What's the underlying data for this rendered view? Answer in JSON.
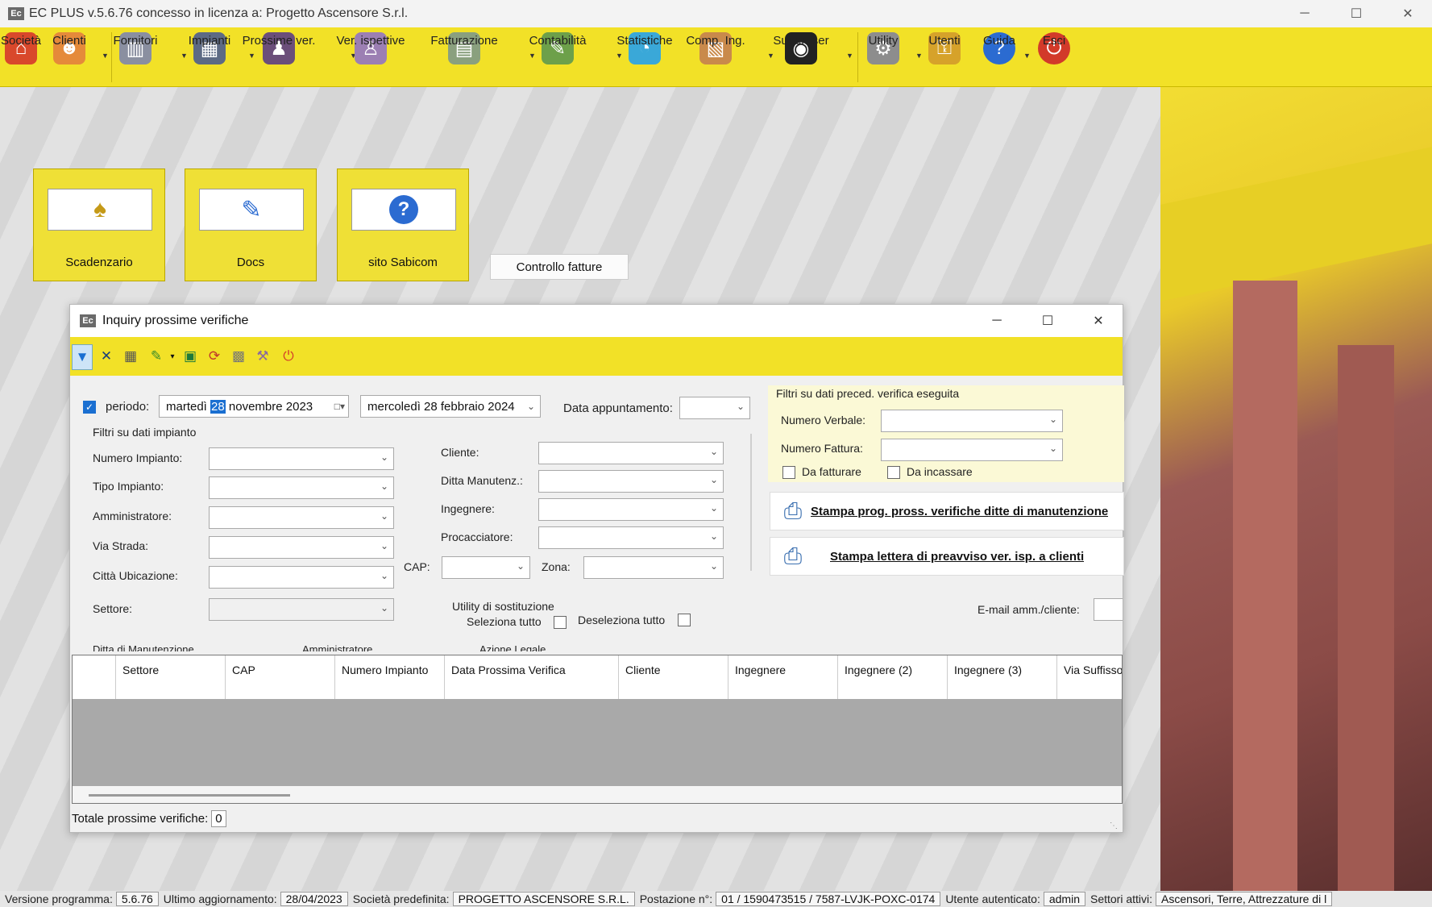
{
  "window": {
    "icon_text": "Ec",
    "title": "EC PLUS v.5.6.76 concesso in licenza a: Progetto Ascensore S.r.l.",
    "controls": {
      "minimize": "─",
      "maximize": "☐",
      "close": "✕"
    }
  },
  "toolbar": {
    "items": [
      {
        "label": "Società",
        "icon": "home-icon",
        "color": "#d9482b",
        "glyph": "⌂"
      },
      {
        "label": "Clienti",
        "icon": "users-icon",
        "color": "#e58a3a",
        "glyph": "☻"
      },
      {
        "label": "Fornitori",
        "icon": "factory-icon",
        "color": "#8a8fa0",
        "glyph": "▥"
      },
      {
        "label": "Impianti",
        "icon": "building-icon",
        "color": "#5d6a84",
        "glyph": "▦"
      },
      {
        "label": "Prossime ver.",
        "icon": "worker-icon",
        "color": "#6b4e7a",
        "glyph": "♟"
      },
      {
        "label": "Ver. ispettive",
        "icon": "inspector-icon",
        "color": "#9c7fb3",
        "glyph": "♙"
      },
      {
        "label": "Fatturazione",
        "icon": "calculator-icon",
        "color": "#8aa07e",
        "glyph": "▤"
      },
      {
        "label": "Contabilità",
        "icon": "accounting-icon",
        "color": "#6da04a",
        "glyph": "✎"
      },
      {
        "label": "Statistiche",
        "icon": "chart-icon",
        "color": "#3aa8d8",
        "glyph": "◔"
      },
      {
        "label": "Comp. Ing.",
        "icon": "box-icon",
        "color": "#c98a4b",
        "glyph": "▧"
      },
      {
        "label": "Superuser",
        "icon": "superuser-icon",
        "color": "#222222",
        "glyph": "◉"
      },
      {
        "label": "Utility",
        "icon": "gear-icon",
        "color": "#8d8d8d",
        "glyph": "⚙"
      },
      {
        "label": "Utenti",
        "icon": "key-icon",
        "color": "#d6a22a",
        "glyph": "⚿"
      },
      {
        "label": "Guida",
        "icon": "help-icon",
        "color": "#2b6bd1",
        "glyph": "?"
      },
      {
        "label": "Esci",
        "icon": "power-icon",
        "color": "#d23a2a",
        "glyph": "⏻"
      }
    ]
  },
  "tiles": [
    {
      "label": "Scadenzario",
      "icon": "bell-icon",
      "glyph": "🔔"
    },
    {
      "label": "Docs",
      "icon": "edit-document-icon",
      "glyph": "✎"
    },
    {
      "label": "sito Sabicom",
      "icon": "help-icon",
      "glyph": "?"
    }
  ],
  "controllo_fatture": "Controllo fatture",
  "inquiry": {
    "title": "Inquiry prossime verifiche",
    "periodo_label": "periodo:",
    "date_from_pre": "martedì",
    "date_from_sel": "28",
    "date_from_post": "novembre 2023",
    "date_to": "mercoledì 28  febbraio  2024",
    "data_appuntamento": "Data appuntamento:",
    "filtri_impianto": "Filtri su dati impianto",
    "numero_impianto": "Numero Impianto:",
    "tipo_impianto": "Tipo Impianto:",
    "amministratore": "Amministratore:",
    "via_strada": "Via Strada:",
    "citta": "Città Ubicazione:",
    "settore": "Settore:",
    "cliente": "Cliente:",
    "ditta_manutenz": "Ditta Manutenz.:",
    "ingegnere": "Ingegnere:",
    "procacciatore": "Procacciatore:",
    "cap": "CAP:",
    "zona": "Zona:",
    "utility_sostituzione": "Utility di sostituzione",
    "seleziona_tutto": "Seleziona tutto",
    "deseleziona_tutto": "Deseleziona tutto",
    "ditta_manutenzione_cut": "Ditta di Manutenzione",
    "amministratore_cut": "Amministratore",
    "azione_legale_cut": "Azione Legale",
    "filtri_preced": "Filtri su dati preced. verifica eseguita",
    "numero_verbale": "Numero Verbale:",
    "numero_fattura": "Numero Fattura:",
    "da_fatturare": "Da fatturare",
    "da_incassare": "Da incassare",
    "stampa_prog": "Stampa prog. pross. verifiche ditte di manutenzione",
    "stampa_lettera": "Stampa lettera di preavviso ver. isp. a clienti",
    "email": "E-mail amm./cliente:",
    "columns": [
      "Settore",
      "CAP",
      "Numero Impianto",
      "Data Prossima Verifica",
      "Cliente",
      "Ingegnere",
      "Ingegnere (2)",
      "Ingegnere (3)",
      "Via Suffisso"
    ],
    "totale_label": "Totale prossime verifiche:",
    "totale_value": "0"
  },
  "status": {
    "versione_label": "Versione programma:",
    "versione": "5.6.76",
    "aggiornamento_label": "Ultimo aggiornamento:",
    "aggiornamento": "28/04/2023",
    "societa_label": "Società predefinita:",
    "societa": "PROGETTO ASCENSORE S.R.L.",
    "postazione_label": "Postazione n°:",
    "postazione": "01 / 1590473515 / 7587-LVJK-POXC-0174",
    "utente_label": "Utente autenticato:",
    "utente": "admin",
    "settori_label": "Settori attivi:",
    "settori": "Ascensori, Terre, Attrezzature di l"
  }
}
